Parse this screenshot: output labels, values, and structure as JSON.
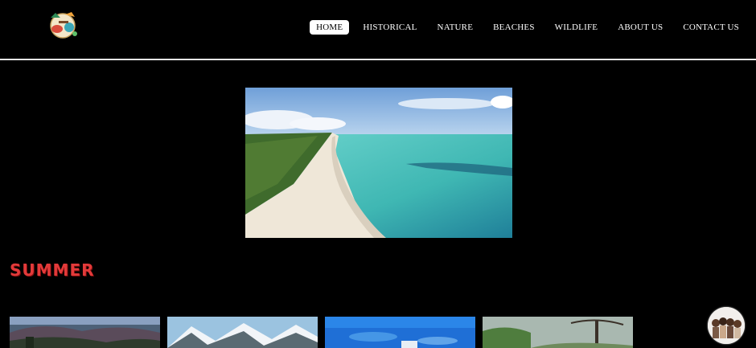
{
  "header": {
    "logo_icon": "travel-globe-logo-icon",
    "nav": [
      {
        "label": "HOME",
        "active": true
      },
      {
        "label": "HISTORICAL",
        "active": false
      },
      {
        "label": "NATURE",
        "active": false
      },
      {
        "label": "BEACHES",
        "active": false
      },
      {
        "label": "WILDLIFE",
        "active": false
      },
      {
        "label": "ABOUT US",
        "active": false
      },
      {
        "label": "CONTACT US",
        "active": false
      }
    ]
  },
  "hero": {
    "image": "tropical-beach-aerial-image"
  },
  "section": {
    "title": "SUMMER",
    "title_color": "#e23a3a",
    "thumbnails": [
      "hill-town-image",
      "snowy-mountains-image",
      "blue-water-image",
      "forest-trees-image"
    ]
  },
  "chat_widget": {
    "icon": "group-avatar-icon"
  }
}
